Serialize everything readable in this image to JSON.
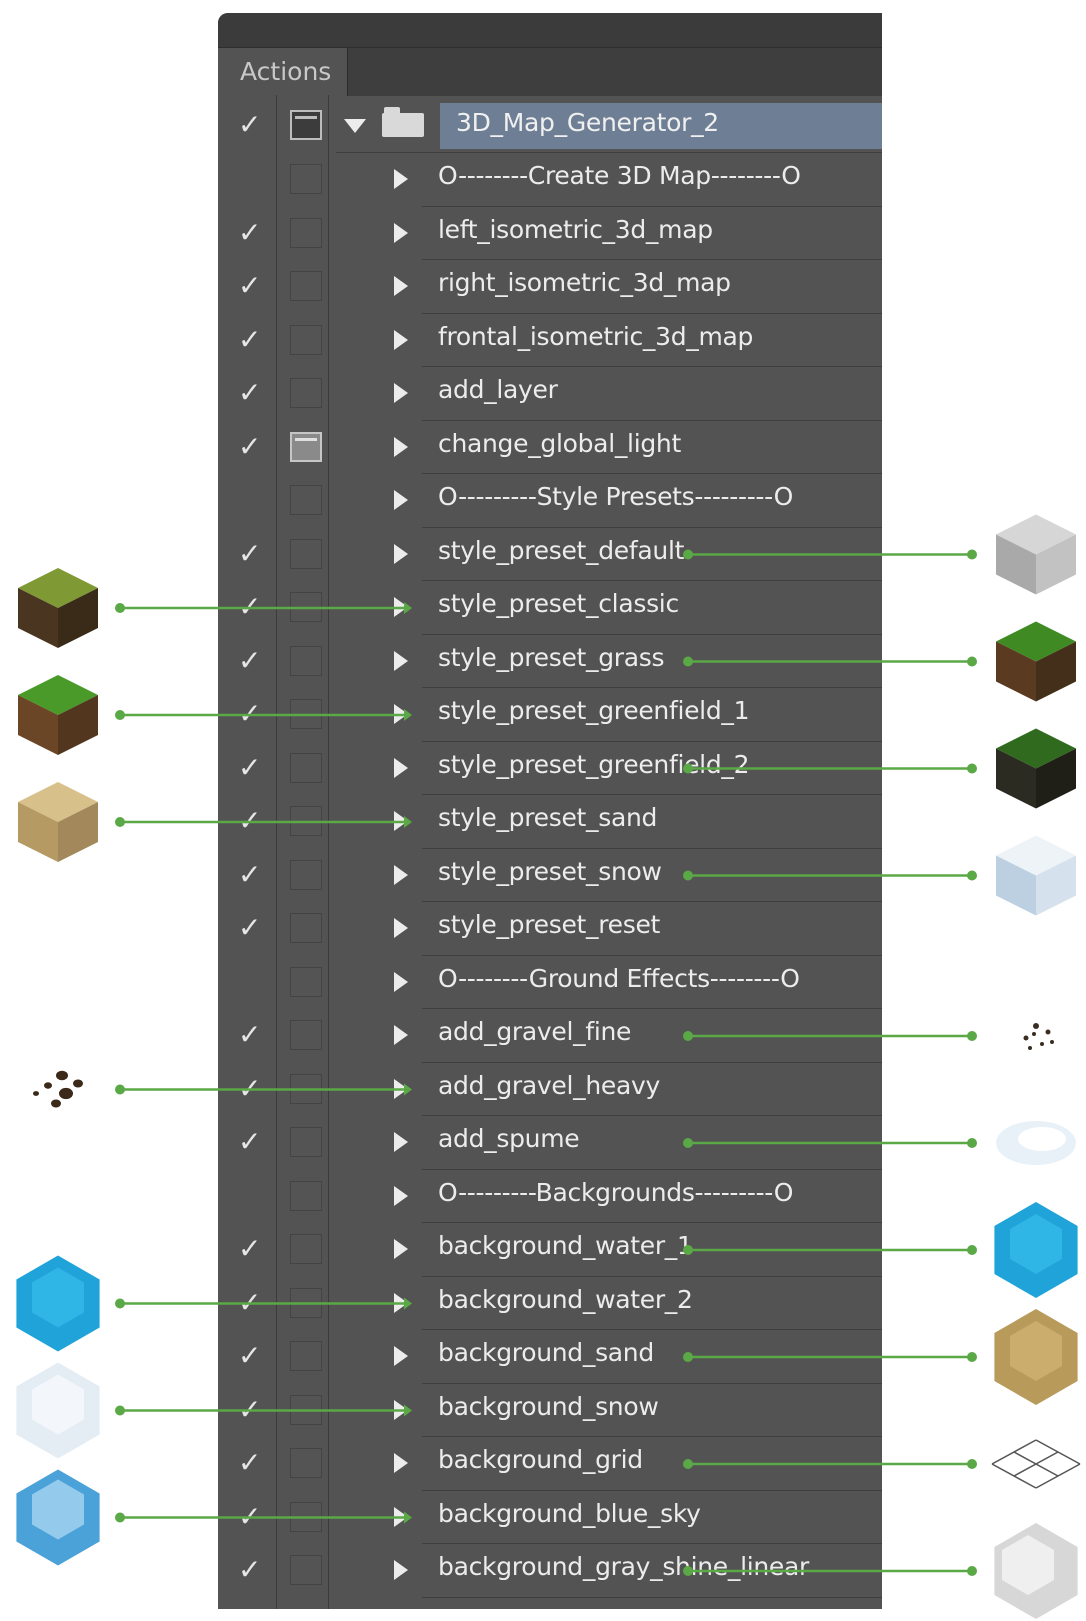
{
  "panel": {
    "tab_label": "Actions"
  },
  "folder": {
    "name": "3D_Map_Generator_2",
    "checked": true
  },
  "actions": [
    {
      "label": "O--------Create 3D Map--------O",
      "checked": false,
      "dialog": "off"
    },
    {
      "label": "left_isometric_3d_map",
      "checked": true,
      "dialog": "off"
    },
    {
      "label": "right_isometric_3d_map",
      "checked": true,
      "dialog": "off"
    },
    {
      "label": "frontal_isometric_3d_map",
      "checked": true,
      "dialog": "off"
    },
    {
      "label": "add_layer",
      "checked": true,
      "dialog": "off"
    },
    {
      "label": "change_global_light",
      "checked": true,
      "dialog": "on"
    },
    {
      "label": "O---------Style Presets---------O",
      "checked": false,
      "dialog": "off"
    },
    {
      "label": "style_preset_default",
      "checked": true,
      "dialog": "off"
    },
    {
      "label": "style_preset_classic",
      "checked": true,
      "dialog": "off"
    },
    {
      "label": "style_preset_grass",
      "checked": true,
      "dialog": "off"
    },
    {
      "label": "style_preset_greenfield_1",
      "checked": true,
      "dialog": "off"
    },
    {
      "label": "style_preset_greenfield_2",
      "checked": true,
      "dialog": "off"
    },
    {
      "label": "style_preset_sand",
      "checked": true,
      "dialog": "off"
    },
    {
      "label": "style_preset_snow",
      "checked": true,
      "dialog": "off"
    },
    {
      "label": "style_preset_reset",
      "checked": true,
      "dialog": "off"
    },
    {
      "label": "O--------Ground Effects--------O",
      "checked": false,
      "dialog": "off"
    },
    {
      "label": "add_gravel_fine",
      "checked": true,
      "dialog": "off"
    },
    {
      "label": "add_gravel_heavy",
      "checked": true,
      "dialog": "off"
    },
    {
      "label": "add_spume",
      "checked": true,
      "dialog": "off"
    },
    {
      "label": "O---------Backgrounds---------O",
      "checked": false,
      "dialog": "off"
    },
    {
      "label": "background_water_1",
      "checked": true,
      "dialog": "off"
    },
    {
      "label": "background_water_2",
      "checked": true,
      "dialog": "off"
    },
    {
      "label": "background_sand",
      "checked": true,
      "dialog": "off"
    },
    {
      "label": "background_snow",
      "checked": true,
      "dialog": "off"
    },
    {
      "label": "background_grid",
      "checked": true,
      "dialog": "off"
    },
    {
      "label": "background_blue_sky",
      "checked": true,
      "dialog": "off"
    },
    {
      "label": "background_gray_shine_linear",
      "checked": true,
      "dialog": "off"
    }
  ],
  "preview_thumbnails": [
    {
      "action": "style_preset_default",
      "side": "right",
      "icon": "gray-cube-icon"
    },
    {
      "action": "style_preset_classic",
      "side": "left",
      "icon": "classic-grass-cube-icon"
    },
    {
      "action": "style_preset_grass",
      "side": "right",
      "icon": "grass-cube-icon"
    },
    {
      "action": "style_preset_greenfield_1",
      "side": "left",
      "icon": "greenfield-cube-icon"
    },
    {
      "action": "style_preset_greenfield_2",
      "side": "right",
      "icon": "dark-greenfield-cube-icon"
    },
    {
      "action": "style_preset_sand",
      "side": "left",
      "icon": "sand-cube-icon"
    },
    {
      "action": "style_preset_snow",
      "side": "right",
      "icon": "snow-cube-icon"
    },
    {
      "action": "add_gravel_fine",
      "side": "right",
      "icon": "fine-gravel-icon"
    },
    {
      "action": "add_gravel_heavy",
      "side": "left",
      "icon": "heavy-gravel-icon"
    },
    {
      "action": "add_spume",
      "side": "right",
      "icon": "spume-icon"
    },
    {
      "action": "background_water_1",
      "side": "right",
      "icon": "water-hexagon-icon"
    },
    {
      "action": "background_water_2",
      "side": "left",
      "icon": "water-hexagon-icon"
    },
    {
      "action": "background_sand",
      "side": "right",
      "icon": "sand-hexagon-icon"
    },
    {
      "action": "background_snow",
      "side": "left",
      "icon": "snow-hexagon-icon"
    },
    {
      "action": "background_grid",
      "side": "right",
      "icon": "grid-icon"
    },
    {
      "action": "background_blue_sky",
      "side": "left",
      "icon": "blue-sky-hexagon-icon"
    },
    {
      "action": "background_gray_shine_linear",
      "side": "right",
      "icon": "gray-shine-hexagon-icon"
    }
  ],
  "colors": {
    "panel_bg": "#535353",
    "folder_highlight": "#6e7f95",
    "callout_line": "#5aa846",
    "text": "#ececec"
  }
}
